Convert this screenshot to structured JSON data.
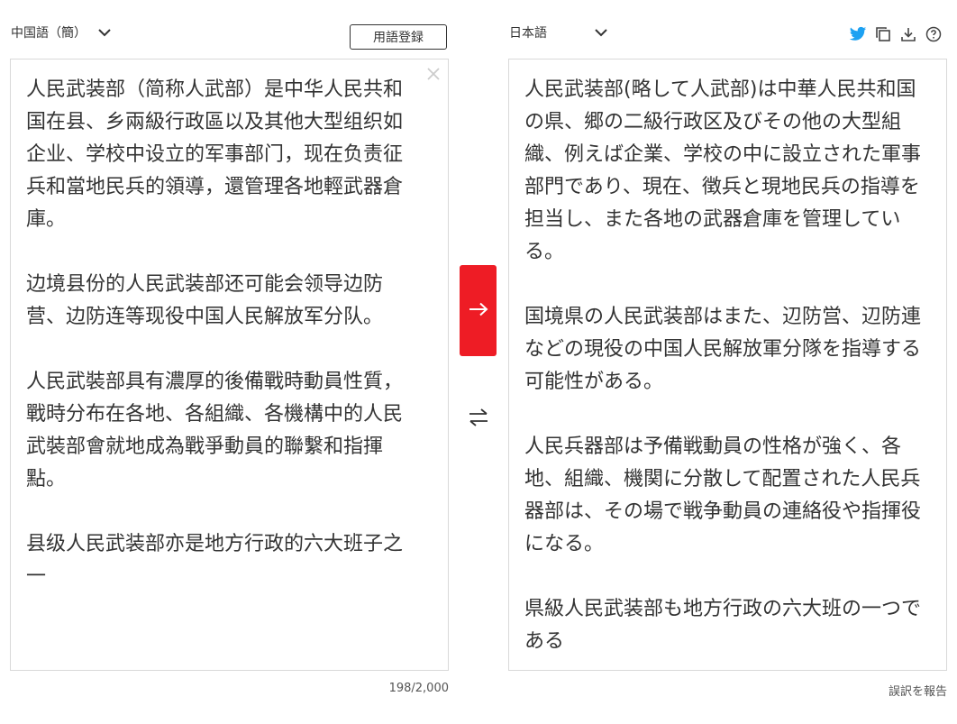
{
  "source": {
    "language_label": "中国語（簡）",
    "dictionary_button": "用語登録",
    "text": "人民武装部（简称人武部）是中华人民共和国在县、乡兩級行政區以及其他大型组织如企业、学校中设立的军事部门，现在负责征兵和當地民兵的領導，還管理各地輕武器倉庫。\n\n边境县份的人民武装部还可能会领导边防营、边防连等现役中国人民解放军分队。\n\n人民武裝部具有濃厚的後備戰時動員性質，戰時分布在各地、各組織、各機構中的人民武裝部會就地成為戰爭動員的聯繫和指揮點。\n\n县级人民武装部亦是地方行政的六大班子之一",
    "char_count": "198/2,000"
  },
  "target": {
    "language_label": "日本語",
    "text": "人民武装部(略して人武部)は中華人民共和国の県、郷の二級行政区及びその他の大型組織、例えば企業、学校の中に設立された軍事部門であり、現在、徴兵と現地民兵の指導を担当し、また各地の武器倉庫を管理している。\n\n国境県の人民武装部はまた、辺防営、辺防連などの現役の中国人民解放軍分隊を指導する可能性がある。\n\n人民兵器部は予備戦動員の性格が強く、各地、組織、機関に分散して配置された人民兵器部は、その場で戦争動員の連絡役や指揮役になる。\n\n県級人民武装部も地方行政の六大班の一つである",
    "report_link": "誤訳を報告"
  },
  "icons": {
    "source_chevron": "chevron-down-icon",
    "target_chevron": "chevron-down-icon",
    "clear": "close-icon",
    "twitter": "twitter-icon",
    "copy": "copy-icon",
    "download": "download-icon",
    "help": "help-icon",
    "translate": "arrow-right-icon",
    "swap": "swap-icon"
  },
  "colors": {
    "accent": "#ee1c25",
    "twitter": "#1da1f2",
    "text": "#333333",
    "border": "#d9d9d9"
  }
}
